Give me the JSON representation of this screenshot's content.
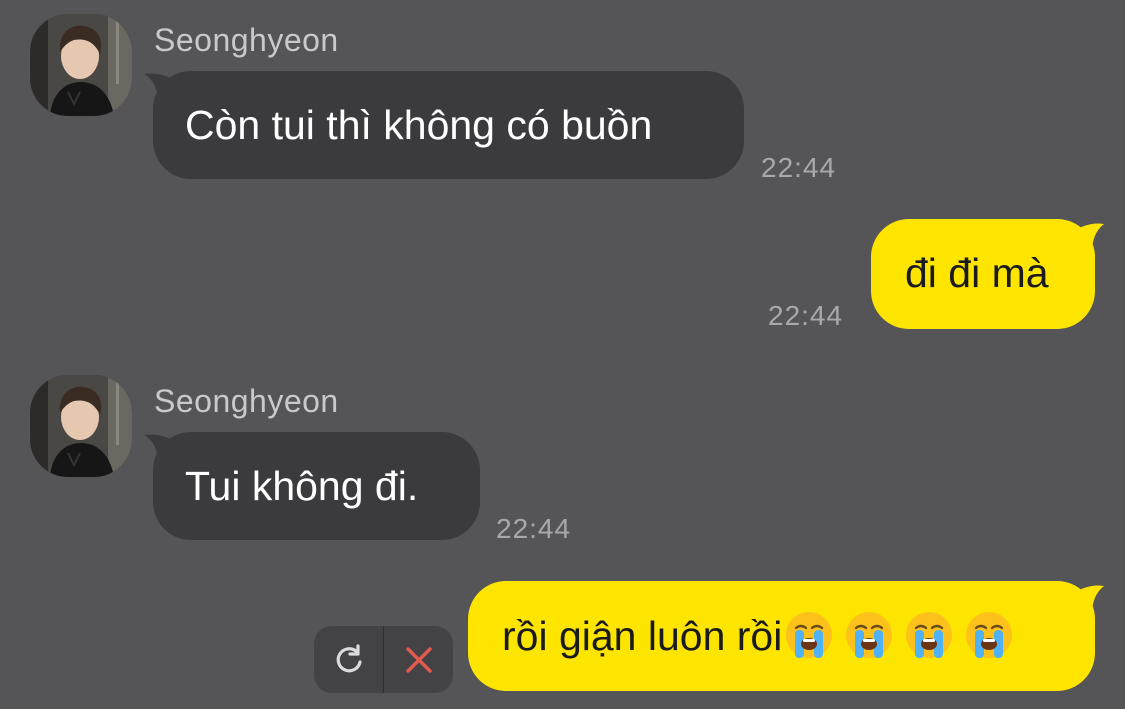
{
  "chat": {
    "messages": [
      {
        "direction": "incoming",
        "sender": "Seonghyeon",
        "text": "Còn tui thì không có buồn",
        "time": "22:44"
      },
      {
        "direction": "outgoing",
        "text": "đi đi mà",
        "time": "22:44"
      },
      {
        "direction": "incoming",
        "sender": "Seonghyeon",
        "text": "Tui không đi.",
        "time": "22:44"
      },
      {
        "direction": "outgoing",
        "text": "rồi giận luôn rồi",
        "emoji_icons": [
          "loudly-crying-face-icon",
          "loudly-crying-face-icon",
          "loudly-crying-face-icon",
          "loudly-crying-face-icon"
        ],
        "status": "failed-to-send"
      }
    ]
  },
  "failed_actions": {
    "retry_icon": "retry-icon",
    "delete_icon": "close-icon"
  },
  "colors": {
    "background": "#555456",
    "incoming_bubble": "#3b3b3d",
    "outgoing_bubble": "#fde500",
    "delete_red": "#e25b4e"
  }
}
